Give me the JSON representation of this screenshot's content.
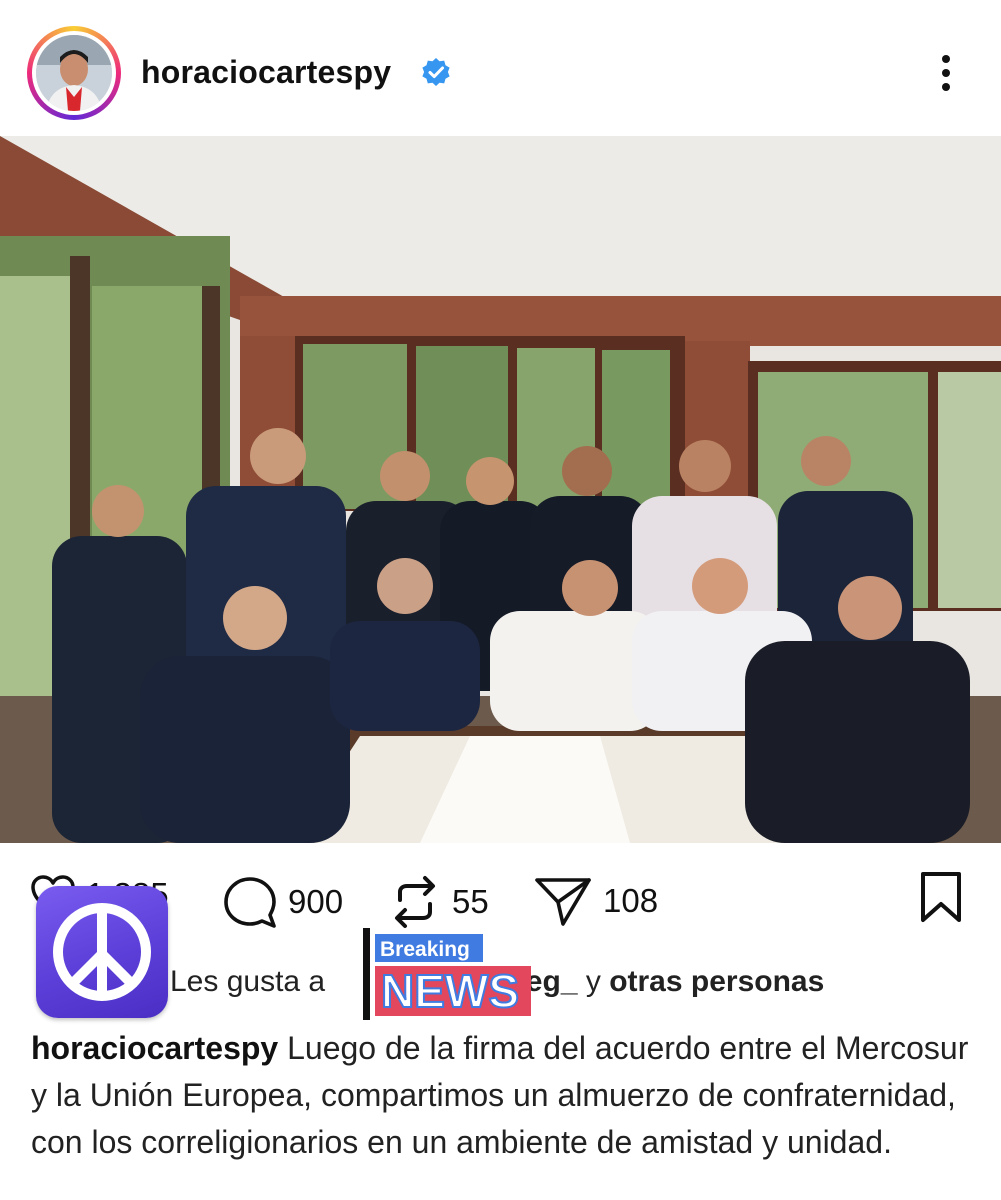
{
  "post": {
    "username": "horaciocartespy",
    "verified_icon": "verified-badge-icon",
    "more_icon": "more-options-icon"
  },
  "actions": {
    "likes_count": "1.385",
    "comments_count": "900",
    "reposts_count": "55",
    "shares_count": "108"
  },
  "overlays": {
    "peace_sticker": "peace-sign-icon",
    "news_sticker_top": "Breaking",
    "news_sticker_bottom": "NEWS"
  },
  "liked_by": {
    "prefix": "Les gusta a",
    "user_fragment": "leg_",
    "joiner": "y",
    "others": "otras personas"
  },
  "caption": {
    "username": "horaciocartespy",
    "text": "Luego de la firma del acuerdo entre el Mercosur y la Unión Europea, compartimos un almuerzo de confraternidad, con los correligionarios en un ambiente de amistad y unidad."
  },
  "colors": {
    "verified_blue": "#3797f0",
    "ring_start": "#f9ce34",
    "ring_mid": "#ee2a7b",
    "sticker_purple": "#5b3fd8",
    "news_red": "#e2475d",
    "news_blue": "#3f7be0"
  }
}
